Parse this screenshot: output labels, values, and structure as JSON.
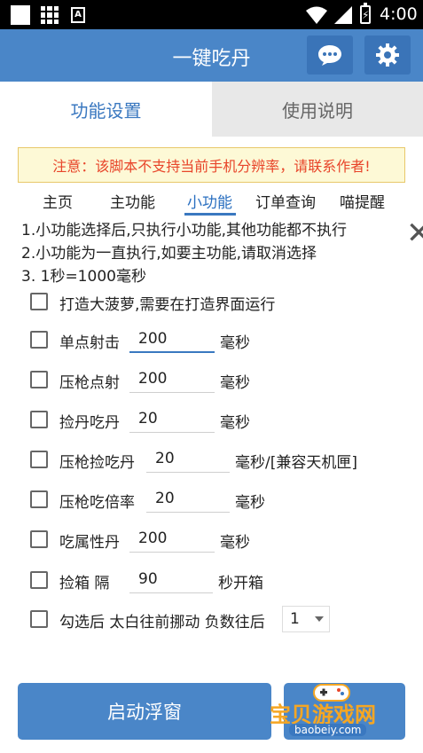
{
  "status_bar": {
    "time": "4:00",
    "app_badge": "A"
  },
  "app_bar": {
    "title": "一键吃丹"
  },
  "tabs": [
    {
      "label": "功能设置",
      "active": true
    },
    {
      "label": "使用说明",
      "active": false
    }
  ],
  "notice": "注意：该脚本不支持当前手机分辨率，请联系作者!",
  "subtabs": [
    {
      "label": "主页"
    },
    {
      "label": "主功能"
    },
    {
      "label": "小功能",
      "active": true
    },
    {
      "label": "订单查询"
    },
    {
      "label": "喵提醒"
    }
  ],
  "info_lines": [
    "1.小功能选择后,只执行小功能,其他功能都不执行",
    "2.小功能为一直执行,如要主功能,请取消选择",
    "3.  1秒=1000毫秒"
  ],
  "options": [
    {
      "label": "打造大菠萝,需要在打造界面运行",
      "checked": false
    },
    {
      "label": "单点射击",
      "value": "200",
      "unit": "毫秒",
      "checked": false
    },
    {
      "label": "压枪点射",
      "value": "200",
      "unit": "毫秒",
      "checked": false
    },
    {
      "label": "捡丹吃丹",
      "value": "20",
      "unit": "毫秒",
      "checked": false
    },
    {
      "label": "压枪捡吃丹",
      "value": "20",
      "unit": "毫秒/[兼容天机匣]",
      "checked": false
    },
    {
      "label": "压枪吃倍率",
      "value": "20",
      "unit": "毫秒",
      "checked": false
    },
    {
      "label": "吃属性丹",
      "value": "200",
      "unit": "毫秒",
      "checked": false
    },
    {
      "label": "捡箱   隔",
      "value": "90",
      "unit": "秒开箱",
      "checked": false
    },
    {
      "label": "勾选后 太白往前挪动 负数往后",
      "select_value": "1",
      "checked": false
    }
  ],
  "buttons": {
    "start_float": "启动浮窗"
  },
  "watermark": {
    "text": "宝贝游戏网",
    "url": "baobeiy.com"
  },
  "colors": {
    "primary": "#4a86c8",
    "notice_text": "#e8452a",
    "notice_bg": "#fdf9d6"
  }
}
